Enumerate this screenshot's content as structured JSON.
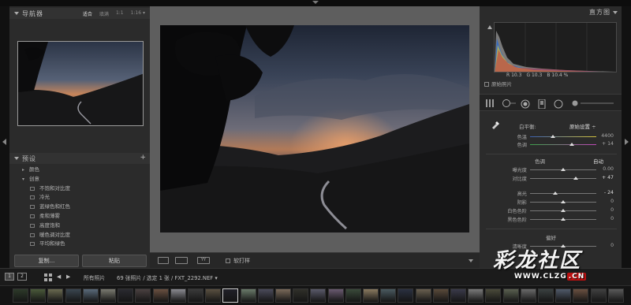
{
  "navigator": {
    "title": "导航器",
    "options": [
      "适合",
      "填满",
      "1:1",
      "1:16 ▾"
    ]
  },
  "presets": {
    "title": "预设",
    "plus": "+",
    "rows": [
      {
        "type": "folder",
        "caret": "▸",
        "label": "颜色"
      },
      {
        "type": "folder",
        "caret": "▾",
        "label": "创意"
      },
      {
        "type": "item",
        "label": "不饱和对比度"
      },
      {
        "type": "item",
        "label": "冷光"
      },
      {
        "type": "item",
        "label": "蓝绿色和红色"
      },
      {
        "type": "item",
        "label": "柔和薄雾"
      },
      {
        "type": "item",
        "label": "高度饱和"
      },
      {
        "type": "item",
        "label": "暖色调对比度"
      },
      {
        "type": "item",
        "label": "平均和绿色"
      }
    ]
  },
  "left_buttons": {
    "copy": "复制...",
    "paste": "粘贴"
  },
  "toolbar": {
    "checkbox_label": "软打样",
    "view_icons": [
      "",
      "YY"
    ]
  },
  "histogram": {
    "title": "直方图",
    "readout": [
      "R 10.3",
      "G 10.3",
      "B 10.4 %"
    ],
    "original_photo_label": "原始照片"
  },
  "basic": {
    "wb_label": "白平衡:",
    "wb_value": "原始设置 ÷",
    "temp_label": "色温",
    "temp_value": "4400",
    "tint_label": "色调",
    "tint_value": "+ 14",
    "tone_label": "色调",
    "auto_label": "自动",
    "exposure_label": "曝光度",
    "exposure_value": "0.00",
    "contrast_label": "对比度",
    "contrast_value": "+ 47",
    "highlights_label": "高光",
    "highlights_value": "- 24",
    "shadows_label": "阴影",
    "shadows_value": "0",
    "whites_label": "白色色阶",
    "whites_value": "0",
    "blacks_label": "黑色色阶",
    "blacks_value": "0",
    "presence_label": "偏好",
    "clarity_label": "清晰度",
    "clarity_value": "0"
  },
  "filmstrip": {
    "page1": "1",
    "page2": "2",
    "source": "所有照片",
    "info": "69 张照片 / 选定 1 张 / FXT_2292.NEF ▾"
  },
  "watermark": {
    "logo": "彩龙社区",
    "url": "WWW.CLZG",
    "url_tld": ".CN"
  }
}
